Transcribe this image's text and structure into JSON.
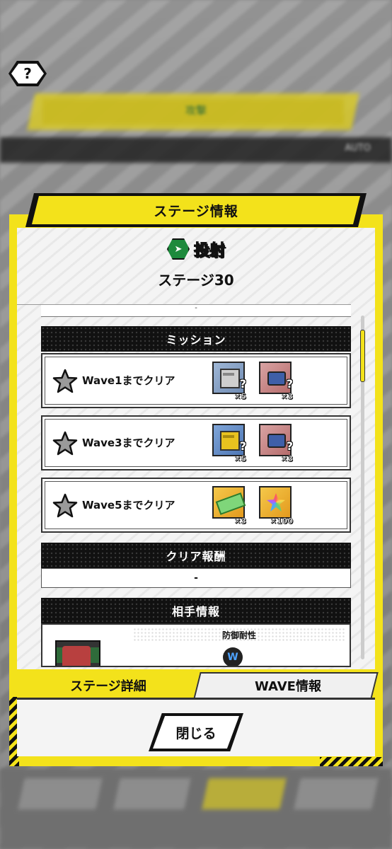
{
  "help": {
    "label": "?"
  },
  "background": {
    "banner_text": "攻撃",
    "auto_label": "AUTO"
  },
  "dialog": {
    "title": "ステージ情報",
    "stage_type": "投射",
    "stage_name": "ステージ30",
    "prev_row_text": "-"
  },
  "mission": {
    "header": "ミッション",
    "rows": [
      {
        "label": "Wave1までクリア",
        "rewards": [
          {
            "icon": "gray-crate-icon",
            "qty": "×5",
            "q": "?"
          },
          {
            "icon": "blue-parts-icon",
            "qty": "×3",
            "q": "?"
          }
        ]
      },
      {
        "label": "Wave3までクリア",
        "rewards": [
          {
            "icon": "gold-crate-icon",
            "qty": "×5",
            "q": "?"
          },
          {
            "icon": "blue-parts-icon",
            "qty": "×3",
            "q": "?"
          }
        ]
      },
      {
        "label": "Wave5までクリア",
        "rewards": [
          {
            "icon": "ticket-icon",
            "qty": "×3",
            "q": ""
          },
          {
            "icon": "rainbow-crystal-icon",
            "qty": "×100",
            "q": ""
          }
        ]
      }
    ]
  },
  "clear_reward": {
    "header": "クリア報酬",
    "value": "-"
  },
  "opponent": {
    "header": "相手情報",
    "defense_label": "防御耐性",
    "defense_icon_text": "W"
  },
  "tabs": {
    "stage_detail": "ステージ詳細",
    "wave_info": "WAVE情報"
  },
  "close_button": "閉じる",
  "colors": {
    "accent_yellow": "#f3e21b",
    "dark": "#111111",
    "type_green": "#1d8a3c"
  }
}
